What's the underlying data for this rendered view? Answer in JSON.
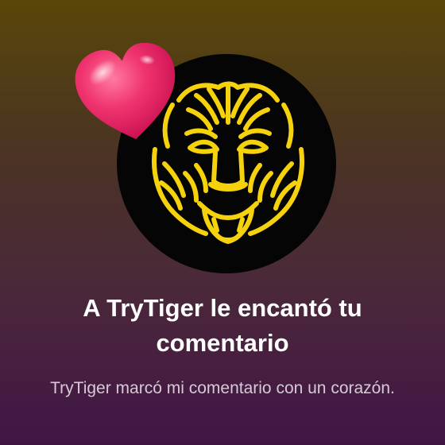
{
  "notification": {
    "title": "A TryTiger le encantó tu comentario",
    "subtitle": "TryTiger marcó mi comentario con un corazón."
  },
  "avatar": {
    "icon": "tiger-face-icon",
    "background_color": "#050505",
    "line_color": "#f5d20c"
  },
  "reaction": {
    "icon": "heart-icon",
    "color": "#f0346f"
  },
  "background_colors": [
    "#5a4608",
    "#3f1546"
  ]
}
